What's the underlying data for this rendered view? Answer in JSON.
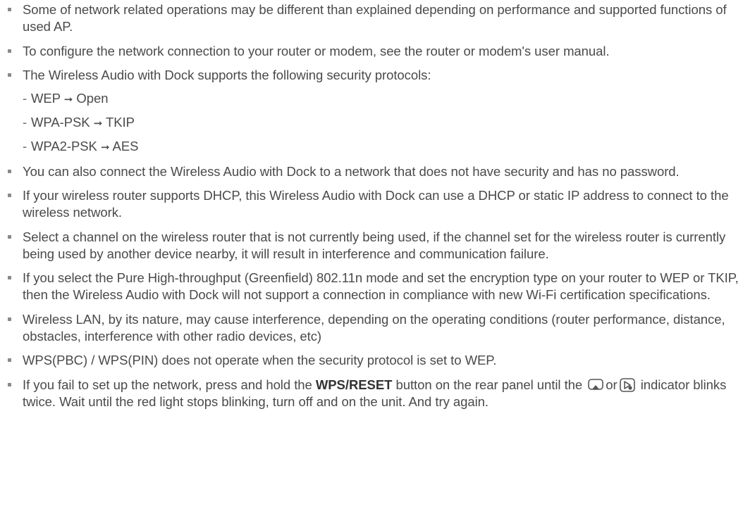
{
  "notes": [
    {
      "text": "Some of network related operations may be different than explained depending on performance and supported functions of used AP."
    },
    {
      "text": "To configure the network connection to your router or modem, see the router or modem's user manual."
    },
    {
      "text": "The Wireless Audio with Dock supports the following security protocols:",
      "protocols": [
        {
          "name": "WEP",
          "arrow": "➞",
          "value": "Open"
        },
        {
          "name": "WPA-PSK",
          "arrow": "➞",
          "value": "TKIP"
        },
        {
          "name": "WPA2-PSK",
          "arrow": "➞",
          "value": "AES"
        }
      ]
    },
    {
      "text": "You can also connect the Wireless Audio with Dock to a network that does not have security and has no password."
    },
    {
      "text": "If your wireless router supports DHCP, this Wireless Audio with Dock can use a DHCP or static IP address to connect to the wireless network."
    },
    {
      "text": "Select a channel on the wireless router that is not currently being used, if the channel set for the wireless router is currently being used by another device nearby, it will result in interference and communication failure."
    },
    {
      "text": "If you select the Pure High-throughput (Greenfield) 802.11n mode and set the encryption type on your router to WEP or TKIP, then the Wireless Audio with Dock will not support a connection in compliance with new Wi-Fi certification specifications."
    },
    {
      "text": "Wireless LAN, by its nature, may cause interference, depending on the operating conditions (router performance, distance, obstacles, interference with other radio devices, etc)"
    },
    {
      "text": "WPS(PBC) / WPS(PIN) does not operate when the security protocol is set to WEP."
    },
    {
      "text_before": "If you fail to set up the network, press and hold the ",
      "bold": "WPS/RESET",
      "text_middle": " button on the rear panel until the ",
      "or": "or",
      "text_after": " indicator blinks twice. Wait until the red light stops blinking, turn off and on the unit. And try again.",
      "icons": [
        "airplay-indicator-icon",
        "allshare-play-indicator-icon"
      ]
    }
  ],
  "dash": "-"
}
